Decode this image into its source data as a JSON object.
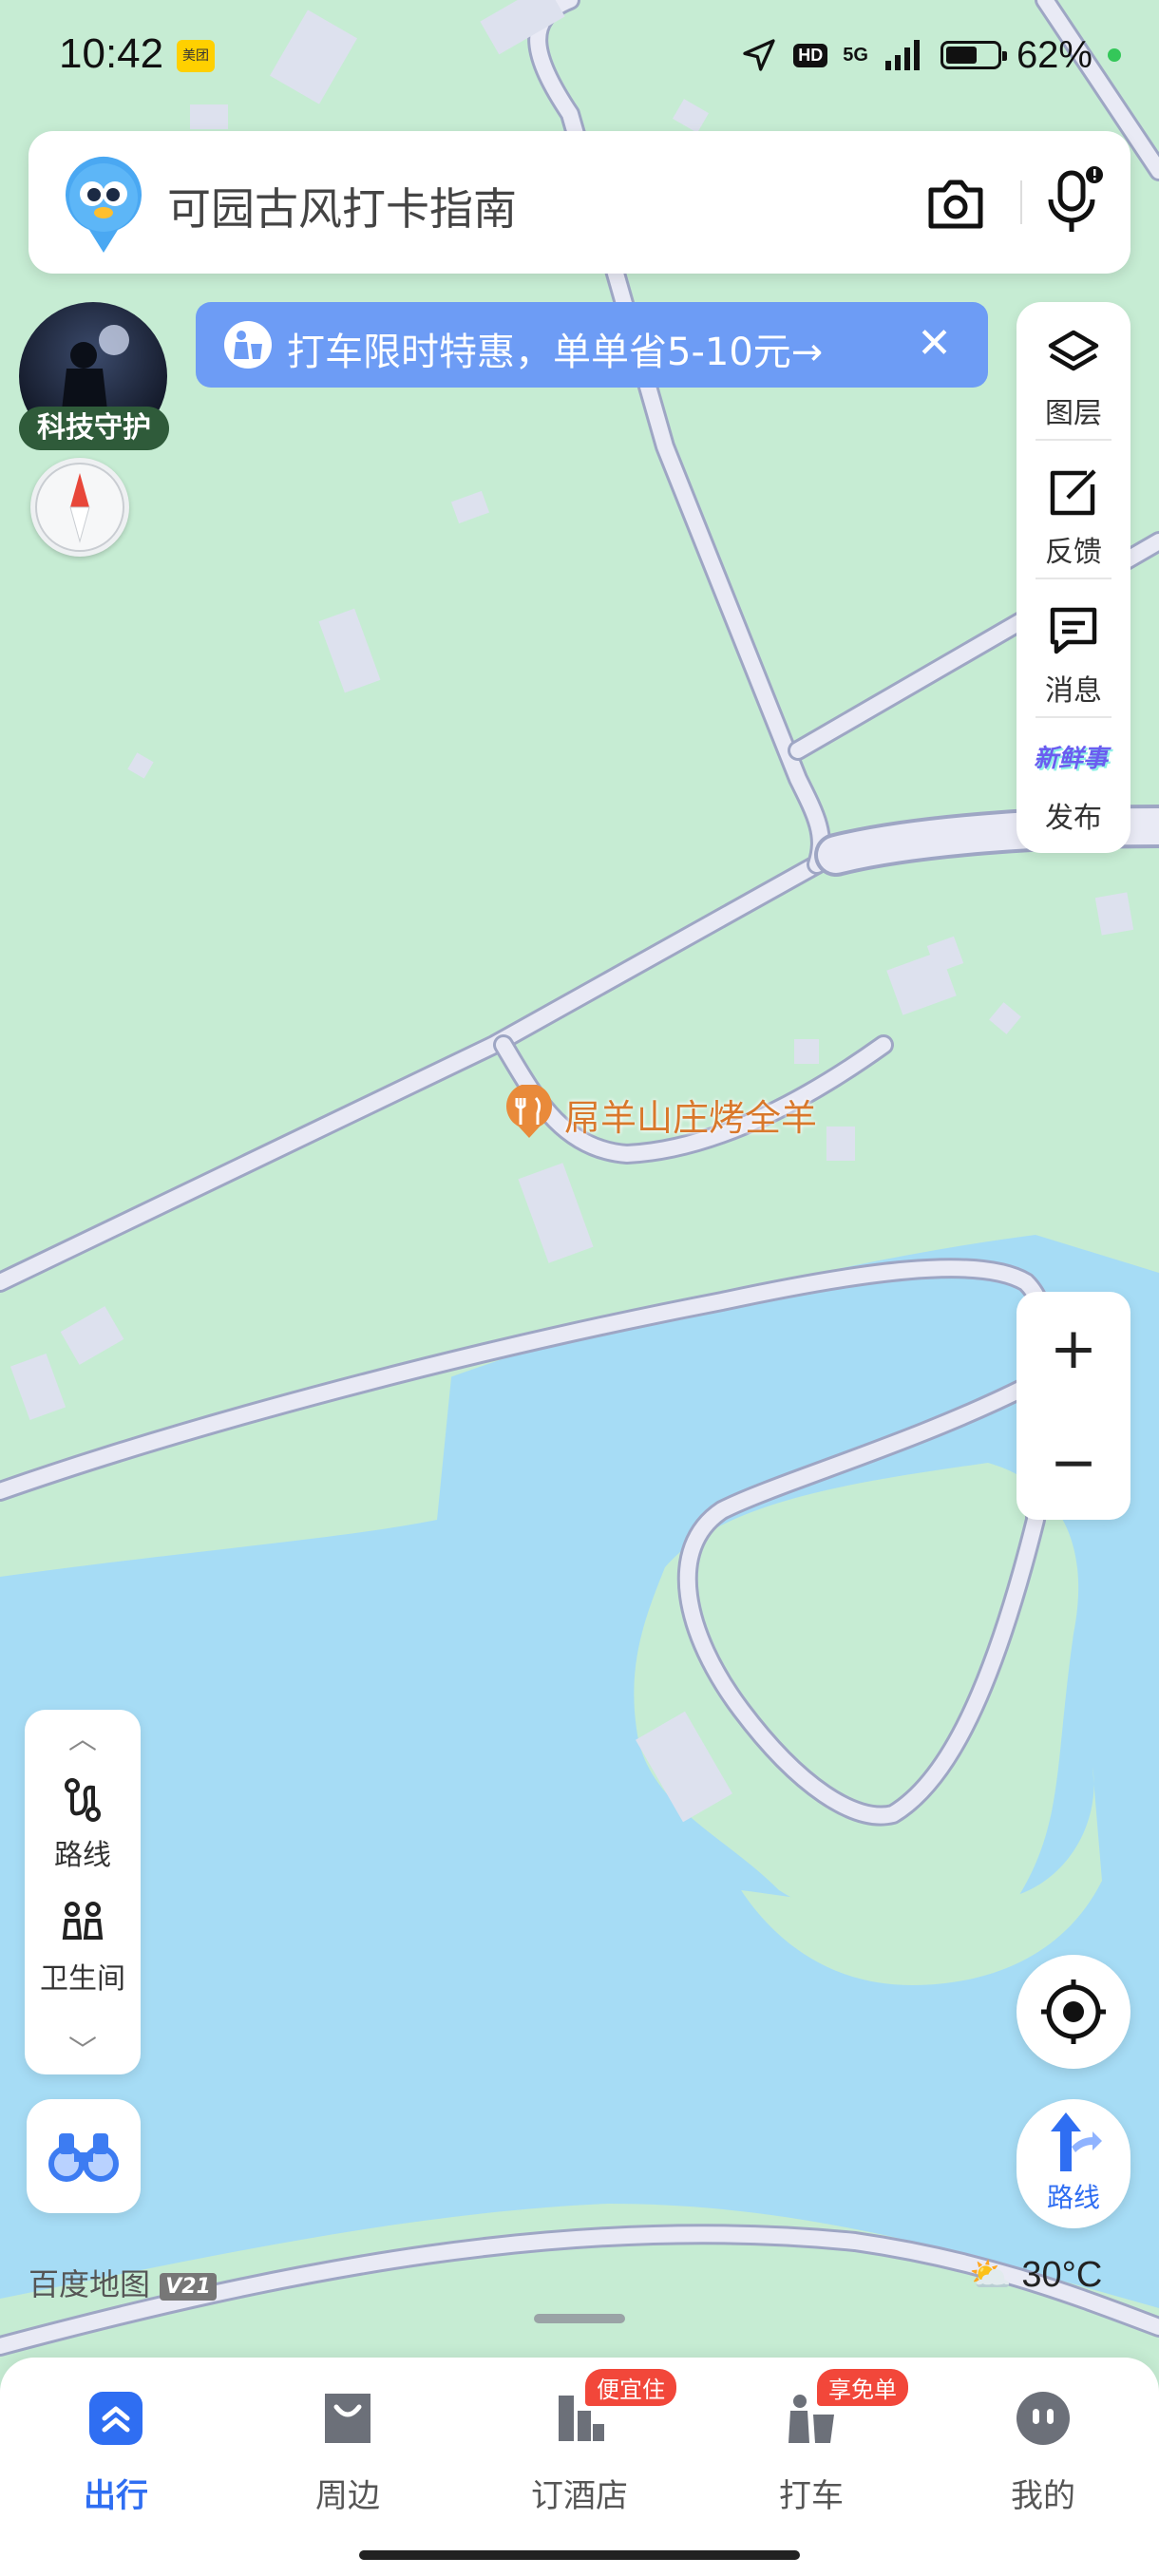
{
  "status_bar": {
    "time": "10:42",
    "app_badge": "美团",
    "network": "5G",
    "battery_percent": 62,
    "battery_text": "62%"
  },
  "search": {
    "text": "可园古风打卡指南",
    "camera_icon": "camera-icon",
    "voice_icon": "microphone-icon"
  },
  "promo": {
    "text": "打车限时特惠，单单省5-10元→",
    "close": "✕"
  },
  "avatar": {
    "badge": "科技守护"
  },
  "tools": {
    "layers": "图层",
    "feedback": "反馈",
    "messages": "消息",
    "publish_badge": "新鲜事",
    "publish": "发布"
  },
  "poi": {
    "name": "屌羊山庄烤全羊"
  },
  "zoom": {
    "in": "+",
    "out": "−"
  },
  "left_panel": {
    "up": "︿",
    "route": "路线",
    "restroom": "卫生间",
    "down": "﹀"
  },
  "route_button": {
    "label": "路线"
  },
  "brand": {
    "name": "百度地图",
    "version": "V21"
  },
  "weather": {
    "temp": "30°C"
  },
  "tabs": [
    {
      "label": "出行",
      "badge": ""
    },
    {
      "label": "周边",
      "badge": ""
    },
    {
      "label": "订酒店",
      "badge": "便宜住"
    },
    {
      "label": "打车",
      "badge": "享免单"
    },
    {
      "label": "我的",
      "badge": ""
    }
  ],
  "colors": {
    "land": "#c6ecd3",
    "water": "#a6dcf5",
    "road": "#e9eaf5",
    "accent": "#2f6ef2",
    "promo": "#6d9cf5",
    "poi": "#e98a3a",
    "badge": "#f2473a"
  }
}
